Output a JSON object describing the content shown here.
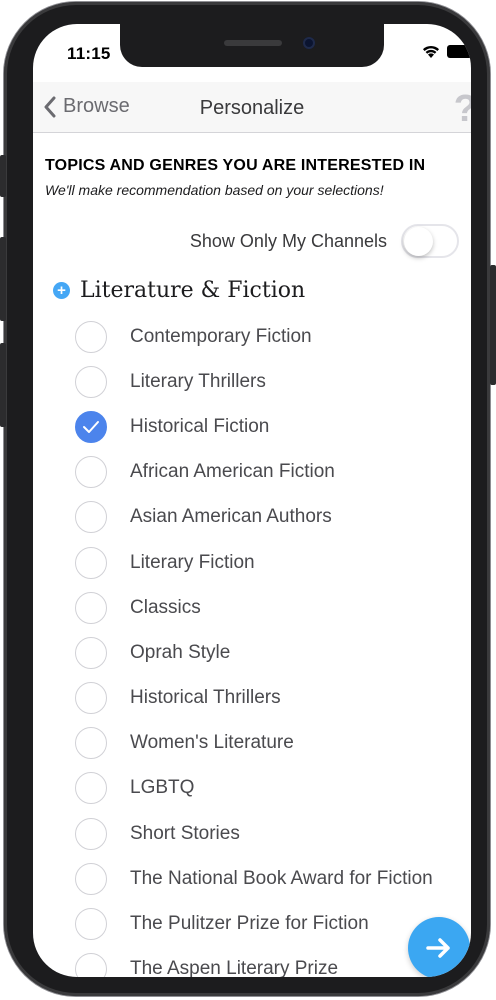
{
  "status_bar": {
    "time": "11:15"
  },
  "navbar": {
    "back_label": "Browse",
    "title": "Personalize",
    "help": "?"
  },
  "header": {
    "title": "TOPICS AND GENRES YOU ARE INTERESTED IN",
    "subtitle": "We'll make recommendation based on your selections!"
  },
  "toggle": {
    "label": "Show Only My Channels",
    "on": false
  },
  "category": {
    "label": "Literature & Fiction",
    "icon": "plus-circle-icon"
  },
  "genres": [
    {
      "label": "Contemporary Fiction",
      "selected": false
    },
    {
      "label": "Literary Thrillers",
      "selected": false
    },
    {
      "label": "Historical Fiction",
      "selected": true
    },
    {
      "label": "African American Fiction",
      "selected": false
    },
    {
      "label": "Asian American Authors",
      "selected": false
    },
    {
      "label": "Literary Fiction",
      "selected": false
    },
    {
      "label": "Classics",
      "selected": false
    },
    {
      "label": "Oprah Style",
      "selected": false
    },
    {
      "label": "Historical Thrillers",
      "selected": false
    },
    {
      "label": "Women's Literature",
      "selected": false
    },
    {
      "label": "LGBTQ",
      "selected": false
    },
    {
      "label": "Short Stories",
      "selected": false
    },
    {
      "label": "The National Book Award for Fiction",
      "selected": false
    },
    {
      "label": "The Pulitzer Prize for Fiction",
      "selected": false
    },
    {
      "label": "The Aspen Literary Prize",
      "selected": false
    }
  ],
  "colors": {
    "accent": "#4c84ec",
    "fab": "#3ba7f2",
    "plus": "#45a7f5"
  }
}
